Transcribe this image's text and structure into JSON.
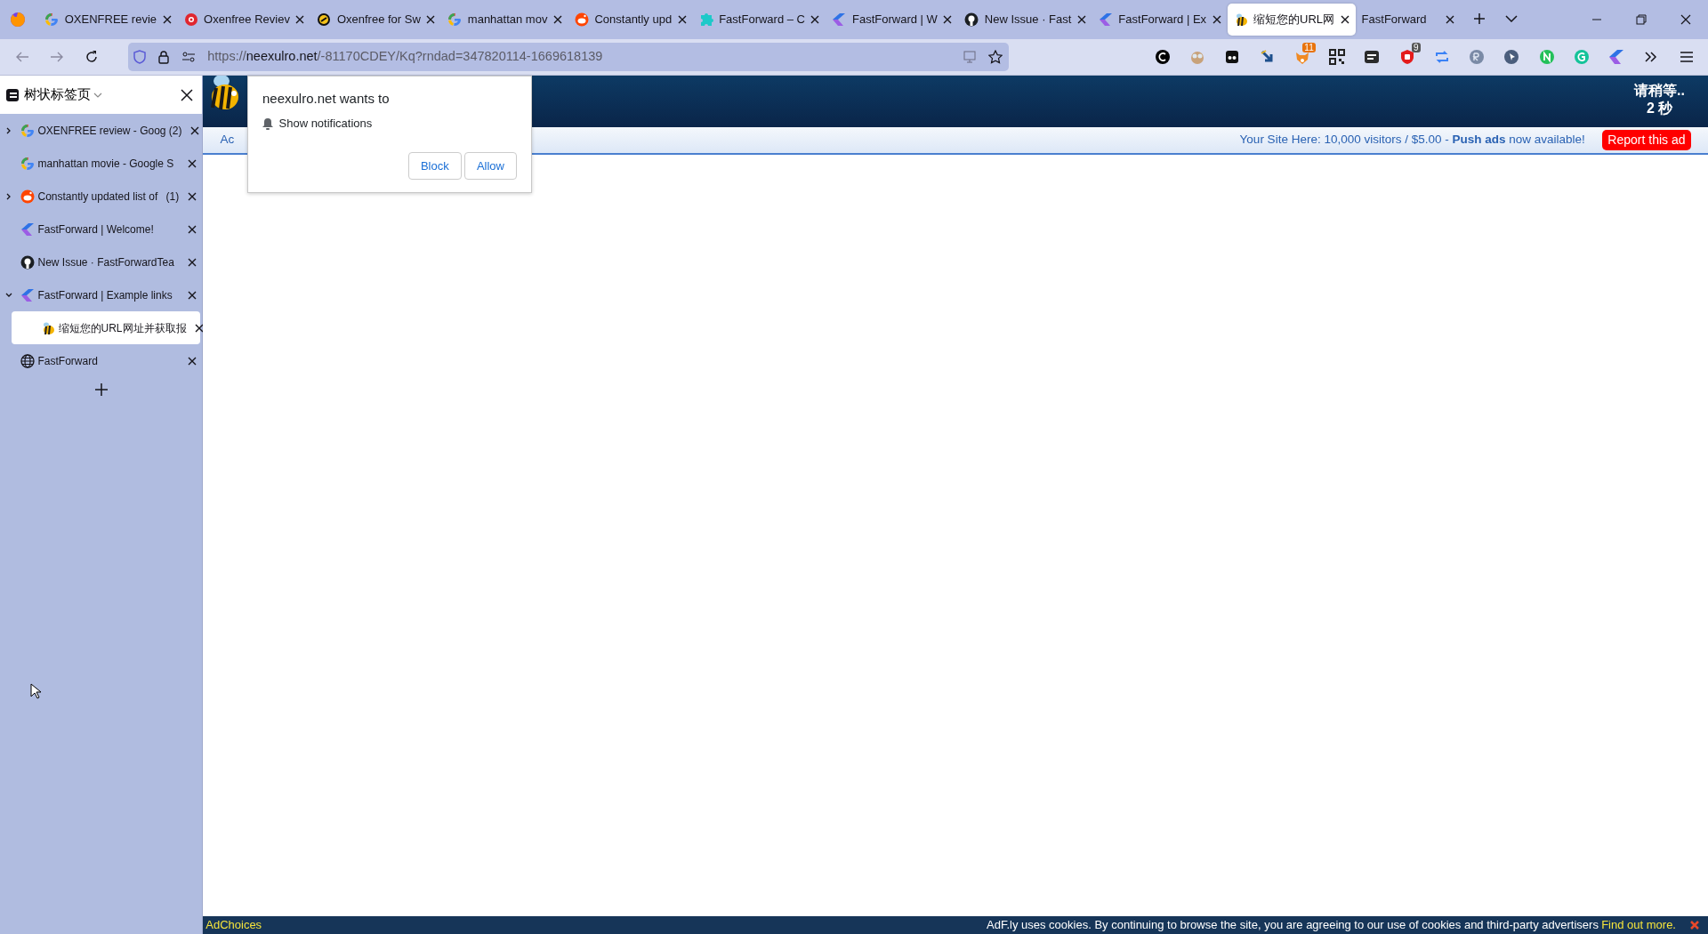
{
  "tabs": [
    {
      "title": "OXENFREE revie",
      "kind": "google",
      "selected": false
    },
    {
      "title": "Oxenfree Reviev",
      "kind": "redgear",
      "selected": false
    },
    {
      "title": "Oxenfree for Sw",
      "kind": "yellowring",
      "selected": false
    },
    {
      "title": "manhattan mov",
      "kind": "google",
      "selected": false
    },
    {
      "title": "Constantly upd",
      "kind": "reddit",
      "selected": false
    },
    {
      "title": "FastForward – C",
      "kind": "puzzle",
      "selected": false
    },
    {
      "title": "FastForward | W",
      "kind": "fastforward",
      "selected": false
    },
    {
      "title": "New Issue · Fast",
      "kind": "github",
      "selected": false
    },
    {
      "title": "FastForward | Ex",
      "kind": "fastforward",
      "selected": false
    },
    {
      "title": "缩短您的URL网",
      "kind": "bee",
      "selected": true
    },
    {
      "title": "FastForward",
      "kind": "none",
      "selected": false
    }
  ],
  "address_bar": {
    "scheme": "https://",
    "host": "neexulro.net",
    "path": "/-81170CDEY/Kq?rndad=347820114-1669618139"
  },
  "extensions": [
    {
      "kind": "blackcircle"
    },
    {
      "kind": "owl"
    },
    {
      "kind": "darksquare"
    },
    {
      "kind": "arrowdown"
    },
    {
      "kind": "fox",
      "badge": "11"
    },
    {
      "kind": "qr"
    },
    {
      "kind": "card"
    },
    {
      "kind": "redshield",
      "badge": "9"
    },
    {
      "kind": "repeat"
    },
    {
      "kind": "greycircle"
    },
    {
      "kind": "navycircle"
    },
    {
      "kind": "greencircle"
    },
    {
      "kind": "tealcircle"
    },
    {
      "kind": "fastforward"
    }
  ],
  "sidebar": {
    "title": "树状标签页",
    "items": [
      {
        "title": "OXENFREE review - Goog",
        "kind": "google",
        "count": "(2)",
        "expanded": false,
        "selected": false
      },
      {
        "title": "manhattan movie - Google S",
        "kind": "google",
        "selected": false
      },
      {
        "title": "Constantly updated list of",
        "kind": "reddit",
        "count": "(1)",
        "expanded": false,
        "selected": false
      },
      {
        "title": "FastForward | Welcome!",
        "kind": "fastforward",
        "selected": false
      },
      {
        "title": "New Issue · FastForwardTea",
        "kind": "github",
        "selected": false
      },
      {
        "title": "FastForward | Example links",
        "kind": "fastforward",
        "expanded": true,
        "selected": false,
        "children": [
          {
            "title": "缩短您的URL网址并获取报",
            "kind": "bee",
            "selected": true
          }
        ]
      },
      {
        "title": "FastForward",
        "kind": "globe",
        "selected": false
      }
    ]
  },
  "page": {
    "wait_text": "请稍等..",
    "countdown": "2 秒",
    "nav_link": "Ac",
    "promo": "Your Site Here: 10,000 visitors / $5.00 - **Push ads** now available!",
    "report_button": "Report this ad",
    "ad_choices": "AdChoices",
    "cookie_notice": "AdF.ly uses cookies. By continuing to browse the site, you are agreeing to our use of cookies and third-party advertisers",
    "cookie_link": "Find out more."
  },
  "permission_popup": {
    "title": "neexulro.net wants to",
    "permission": "Show notifications",
    "buttons": [
      "Block",
      "Allow"
    ]
  }
}
